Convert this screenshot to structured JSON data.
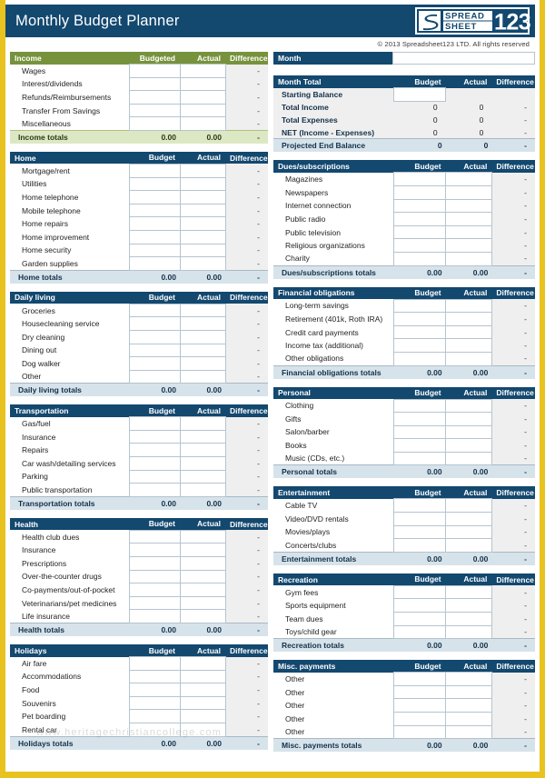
{
  "header": {
    "title": "Monthly Budget Planner",
    "copyright": "© 2013 Spreadsheet123 LTD. All rights reserved",
    "logo_text_top": "SPREAD",
    "logo_text_bottom": "SHEET",
    "logo_number": "123",
    "brand_color": "#13486f",
    "accent_color": "#e8c21e",
    "income_header_color": "#76923c"
  },
  "month": {
    "label": "Month",
    "value": "",
    "placeholder": ""
  },
  "columns": {
    "budgeted": "Budgeted",
    "budget": "Budget",
    "actual": "Actual",
    "difference": "Difference",
    "zero": "0.00",
    "zero_int": "0",
    "dash": "-"
  },
  "left_sections": [
    {
      "name": "income",
      "title": "Income",
      "style": "green",
      "col_budget": "Budgeted",
      "col_actual": "Actual",
      "col_diff": "Difference",
      "rows": [
        {
          "label": "Wages",
          "budget": "",
          "actual": "",
          "diff": "-"
        },
        {
          "label": "Interest/dividends",
          "budget": "",
          "actual": "",
          "diff": "-"
        },
        {
          "label": "Refunds/Reimbursements",
          "budget": "",
          "actual": "",
          "diff": "-"
        },
        {
          "label": "Transfer From Savings",
          "budget": "",
          "actual": "",
          "diff": "-"
        },
        {
          "label": "Miscellaneous",
          "budget": "",
          "actual": "",
          "diff": "-"
        }
      ],
      "total": {
        "label": "Income totals",
        "budget": "0.00",
        "actual": "0.00",
        "diff": "-"
      }
    },
    {
      "name": "home",
      "title": "Home",
      "style": "blue",
      "col_budget": "Budget",
      "col_actual": "Actual",
      "col_diff": "Difference",
      "rows": [
        {
          "label": "Mortgage/rent",
          "budget": "",
          "actual": "",
          "diff": "-"
        },
        {
          "label": "Utilities",
          "budget": "",
          "actual": "",
          "diff": "-"
        },
        {
          "label": "Home telephone",
          "budget": "",
          "actual": "",
          "diff": "-"
        },
        {
          "label": "Mobile telephone",
          "budget": "",
          "actual": "",
          "diff": "-"
        },
        {
          "label": "Home repairs",
          "budget": "",
          "actual": "",
          "diff": "-"
        },
        {
          "label": "Home improvement",
          "budget": "",
          "actual": "",
          "diff": "-"
        },
        {
          "label": "Home security",
          "budget": "",
          "actual": "",
          "diff": "-"
        },
        {
          "label": "Garden supplies",
          "budget": "",
          "actual": "",
          "diff": "-"
        }
      ],
      "total": {
        "label": "Home totals",
        "budget": "0.00",
        "actual": "0.00",
        "diff": "-"
      }
    },
    {
      "name": "daily-living",
      "title": "Daily living",
      "style": "blue",
      "col_budget": "Budget",
      "col_actual": "Actual",
      "col_diff": "Difference",
      "rows": [
        {
          "label": "Groceries",
          "budget": "",
          "actual": "",
          "diff": "-"
        },
        {
          "label": "Housecleaning service",
          "budget": "",
          "actual": "",
          "diff": "-"
        },
        {
          "label": "Dry cleaning",
          "budget": "",
          "actual": "",
          "diff": "-"
        },
        {
          "label": "Dining out",
          "budget": "",
          "actual": "",
          "diff": "-"
        },
        {
          "label": "Dog walker",
          "budget": "",
          "actual": "",
          "diff": "-"
        },
        {
          "label": "Other",
          "budget": "",
          "actual": "",
          "diff": "-"
        }
      ],
      "total": {
        "label": "Daily living totals",
        "budget": "0.00",
        "actual": "0.00",
        "diff": "-"
      }
    },
    {
      "name": "transportation",
      "title": "Transportation",
      "style": "blue",
      "col_budget": "Budget",
      "col_actual": "Actual",
      "col_diff": "Difference",
      "rows": [
        {
          "label": "Gas/fuel",
          "budget": "",
          "actual": "",
          "diff": "-"
        },
        {
          "label": "Insurance",
          "budget": "",
          "actual": "",
          "diff": "-"
        },
        {
          "label": "Repairs",
          "budget": "",
          "actual": "",
          "diff": "-"
        },
        {
          "label": "Car wash/detailing services",
          "budget": "",
          "actual": "",
          "diff": "-"
        },
        {
          "label": "Parking",
          "budget": "",
          "actual": "",
          "diff": "-"
        },
        {
          "label": "Public transportation",
          "budget": "",
          "actual": "",
          "diff": "-"
        }
      ],
      "total": {
        "label": "Transportation totals",
        "budget": "0.00",
        "actual": "0.00",
        "diff": "-"
      }
    },
    {
      "name": "health",
      "title": "Health",
      "style": "blue",
      "col_budget": "Budget",
      "col_actual": "Actual",
      "col_diff": "Difference",
      "rows": [
        {
          "label": "Health club dues",
          "budget": "",
          "actual": "",
          "diff": "-"
        },
        {
          "label": "Insurance",
          "budget": "",
          "actual": "",
          "diff": "-"
        },
        {
          "label": "Prescriptions",
          "budget": "",
          "actual": "",
          "diff": "-"
        },
        {
          "label": "Over-the-counter drugs",
          "budget": "",
          "actual": "",
          "diff": "-"
        },
        {
          "label": "Co-payments/out-of-pocket",
          "budget": "",
          "actual": "",
          "diff": "-"
        },
        {
          "label": "Veterinarians/pet medicines",
          "budget": "",
          "actual": "",
          "diff": "-"
        },
        {
          "label": "Life insurance",
          "budget": "",
          "actual": "",
          "diff": "-"
        }
      ],
      "total": {
        "label": "Health totals",
        "budget": "0.00",
        "actual": "0.00",
        "diff": "-"
      }
    },
    {
      "name": "holidays",
      "title": "Holidays",
      "style": "blue",
      "col_budget": "Budget",
      "col_actual": "Actual",
      "col_diff": "Difference",
      "rows": [
        {
          "label": "Air fare",
          "budget": "",
          "actual": "",
          "diff": "-"
        },
        {
          "label": "Accommodations",
          "budget": "",
          "actual": "",
          "diff": "-"
        },
        {
          "label": "Food",
          "budget": "",
          "actual": "",
          "diff": "-"
        },
        {
          "label": "Souvenirs",
          "budget": "",
          "actual": "",
          "diff": "-"
        },
        {
          "label": "Pet boarding",
          "budget": "",
          "actual": "",
          "diff": "-"
        },
        {
          "label": "Rental car",
          "budget": "",
          "actual": "",
          "diff": "-"
        }
      ],
      "total": {
        "label": "Holidays totals",
        "budget": "0.00",
        "actual": "0.00",
        "diff": "-"
      }
    }
  ],
  "month_total": {
    "name": "month-total",
    "title": "Month Total",
    "col_budget": "Budget",
    "col_actual": "Actual",
    "col_diff": "Difference",
    "rows": [
      {
        "label": "Starting Balance",
        "budget": "",
        "actual": "",
        "diff": "",
        "input": true
      },
      {
        "label": "Total Income",
        "budget": "0",
        "actual": "0",
        "diff": "-"
      },
      {
        "label": "Total Expenses",
        "budget": "0",
        "actual": "0",
        "diff": "-"
      },
      {
        "label": "NET (Income - Expenses)",
        "budget": "0",
        "actual": "0",
        "diff": "-"
      }
    ],
    "total": {
      "label": "Projected End Balance",
      "budget": "0",
      "actual": "0",
      "diff": "-"
    }
  },
  "right_sections": [
    {
      "name": "dues-subscriptions",
      "title": "Dues/subscriptions",
      "style": "blue",
      "col_budget": "Budget",
      "col_actual": "Actual",
      "col_diff": "Difference",
      "rows": [
        {
          "label": "Magazines",
          "budget": "",
          "actual": "",
          "diff": "-"
        },
        {
          "label": "Newspapers",
          "budget": "",
          "actual": "",
          "diff": "-"
        },
        {
          "label": "Internet connection",
          "budget": "",
          "actual": "",
          "diff": "-"
        },
        {
          "label": "Public radio",
          "budget": "",
          "actual": "",
          "diff": "-"
        },
        {
          "label": "Public television",
          "budget": "",
          "actual": "",
          "diff": "-"
        },
        {
          "label": "Religious organizations",
          "budget": "",
          "actual": "",
          "diff": "-"
        },
        {
          "label": "Charity",
          "budget": "",
          "actual": "",
          "diff": "-"
        }
      ],
      "total": {
        "label": "Dues/subscriptions totals",
        "budget": "0.00",
        "actual": "0.00",
        "diff": "-"
      }
    },
    {
      "name": "financial-obligations",
      "title": "Financial obligations",
      "style": "blue",
      "col_budget": "Budget",
      "col_actual": "Actual",
      "col_diff": "Difference",
      "rows": [
        {
          "label": "Long-term savings",
          "budget": "",
          "actual": "",
          "diff": "-"
        },
        {
          "label": "Retirement (401k, Roth IRA)",
          "budget": "",
          "actual": "",
          "diff": "-"
        },
        {
          "label": "Credit card payments",
          "budget": "",
          "actual": "",
          "diff": "-"
        },
        {
          "label": "Income tax (additional)",
          "budget": "",
          "actual": "",
          "diff": "-"
        },
        {
          "label": "Other obligations",
          "budget": "",
          "actual": "",
          "diff": "-"
        }
      ],
      "total": {
        "label": "Financial obligations totals",
        "budget": "0.00",
        "actual": "0.00",
        "diff": "-"
      }
    },
    {
      "name": "personal",
      "title": "Personal",
      "style": "blue",
      "col_budget": "Budget",
      "col_actual": "Actual",
      "col_diff": "Difference",
      "rows": [
        {
          "label": "Clothing",
          "budget": "",
          "actual": "",
          "diff": "-"
        },
        {
          "label": "Gifts",
          "budget": "",
          "actual": "",
          "diff": "-"
        },
        {
          "label": "Salon/barber",
          "budget": "",
          "actual": "",
          "diff": "-"
        },
        {
          "label": "Books",
          "budget": "",
          "actual": "",
          "diff": "-"
        },
        {
          "label": "Music (CDs, etc.)",
          "budget": "",
          "actual": "",
          "diff": "-"
        }
      ],
      "total": {
        "label": "Personal totals",
        "budget": "0.00",
        "actual": "0.00",
        "diff": "-"
      }
    },
    {
      "name": "entertainment",
      "title": "Entertainment",
      "style": "blue",
      "col_budget": "Budget",
      "col_actual": "Actual",
      "col_diff": "Difference",
      "rows": [
        {
          "label": "Cable TV",
          "budget": "",
          "actual": "",
          "diff": "-"
        },
        {
          "label": "Video/DVD rentals",
          "budget": "",
          "actual": "",
          "diff": "-"
        },
        {
          "label": "Movies/plays",
          "budget": "",
          "actual": "",
          "diff": "-"
        },
        {
          "label": "Concerts/clubs",
          "budget": "",
          "actual": "",
          "diff": "-"
        }
      ],
      "total": {
        "label": "Entertainment totals",
        "budget": "0.00",
        "actual": "0.00",
        "diff": "-"
      }
    },
    {
      "name": "recreation",
      "title": "Recreation",
      "style": "blue",
      "col_budget": "Budget",
      "col_actual": "Actual",
      "col_diff": "Difference",
      "rows": [
        {
          "label": "Gym fees",
          "budget": "",
          "actual": "",
          "diff": "-"
        },
        {
          "label": "Sports equipment",
          "budget": "",
          "actual": "",
          "diff": "-"
        },
        {
          "label": "Team dues",
          "budget": "",
          "actual": "",
          "diff": "-"
        },
        {
          "label": "Toys/child gear",
          "budget": "",
          "actual": "",
          "diff": "-"
        }
      ],
      "total": {
        "label": "Recreation totals",
        "budget": "0.00",
        "actual": "0.00",
        "diff": "-"
      }
    },
    {
      "name": "misc-payments",
      "title": "Misc. payments",
      "style": "blue",
      "col_budget": "Budget",
      "col_actual": "Actual",
      "col_diff": "Difference",
      "rows": [
        {
          "label": "Other",
          "budget": "",
          "actual": "",
          "diff": "-"
        },
        {
          "label": "Other",
          "budget": "",
          "actual": "",
          "diff": "-"
        },
        {
          "label": "Other",
          "budget": "",
          "actual": "",
          "diff": "-"
        },
        {
          "label": "Other",
          "budget": "",
          "actual": "",
          "diff": "-"
        },
        {
          "label": "Other",
          "budget": "",
          "actual": "",
          "diff": "-"
        }
      ],
      "total": {
        "label": "Misc. payments totals",
        "budget": "0.00",
        "actual": "0.00",
        "diff": "-"
      }
    }
  ],
  "watermark": "www.heritagechristiancollege.com"
}
